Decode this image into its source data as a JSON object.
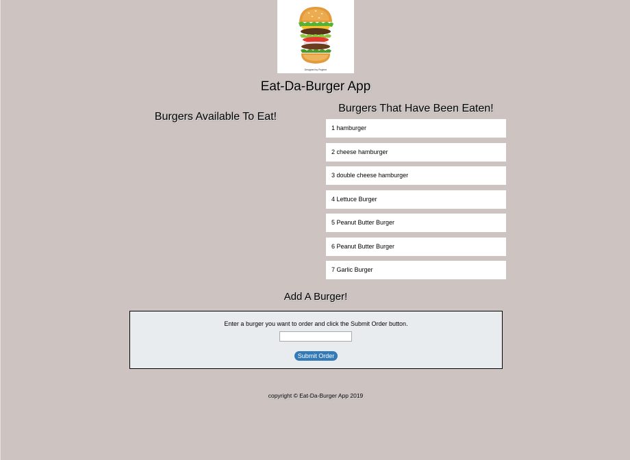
{
  "header": {
    "logo_icon": "burger-logo-icon",
    "logo_caption": "Designed by Pngtree",
    "title": "Eat-Da-Burger App"
  },
  "available": {
    "heading": "Burgers Available To Eat!",
    "items": []
  },
  "eaten": {
    "heading": "Burgers That Have Been Eaten!",
    "items": [
      "1 hamburger",
      "2 cheese hamburger",
      "3 double cheese hamburger",
      "4 Lettuce Burger",
      "5 Peanut Butter Burger",
      "6 Peanut Butter Burger",
      "7 Garlic Burger"
    ]
  },
  "add_burger": {
    "heading": "Add A Burger!",
    "instructions": "Enter a burger you want to order and click the Submit Order button.",
    "input_value": "",
    "submit_label": "Submit Order"
  },
  "footer": {
    "copyright": "copyright © Eat-Da-Burger App 2019"
  },
  "colors": {
    "page_background": "#cdc4c2",
    "panel_background": "#e9ecef",
    "button_primary": "#337ab7"
  }
}
